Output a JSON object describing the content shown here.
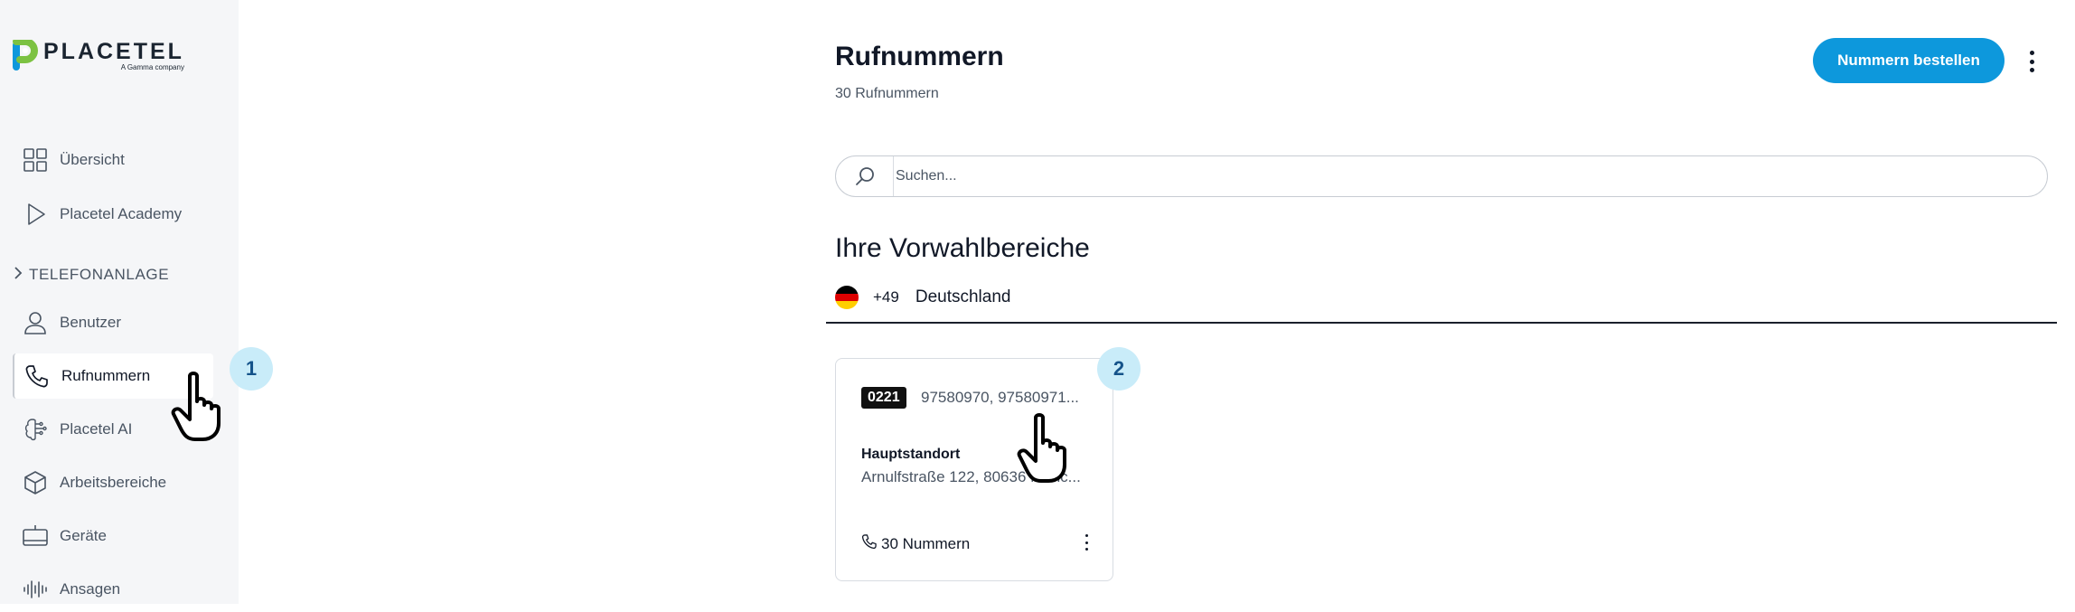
{
  "sidebar": {
    "logo": {
      "word": "PLACETEL",
      "tagline": "A Gamma company"
    },
    "items": [
      {
        "label": "Übersicht",
        "icon": "grid-icon"
      },
      {
        "label": "Placetel Academy",
        "icon": "play-icon"
      },
      {
        "label": "Benutzer",
        "icon": "user-icon"
      },
      {
        "label": "Rufnummern",
        "icon": "phone-icon"
      },
      {
        "label": "Placetel AI",
        "icon": "ai-brain-icon"
      },
      {
        "label": "Arbeitsbereiche",
        "icon": "cube-icon"
      },
      {
        "label": "Geräte",
        "icon": "device-icon"
      },
      {
        "label": "Ansagen",
        "icon": "audio-wave-icon"
      }
    ],
    "section": "TELEFONANLAGE"
  },
  "steps": {
    "one": "1",
    "two": "2"
  },
  "header": {
    "title": "Rufnummern",
    "subtitle": "30 Rufnummern",
    "order_button": "Nummern bestellen"
  },
  "search": {
    "placeholder": "Suchen..."
  },
  "areas": {
    "title": "Ihre Vorwahlbereiche",
    "country": {
      "code": "+49",
      "name": "Deutschland",
      "flag_colors": [
        "#000000",
        "#dd0000",
        "#ffce00"
      ]
    }
  },
  "card": {
    "prefix": "0221",
    "numbers": "97580970, 97580971...",
    "location_name": "Hauptstandort",
    "address": "Arnulfstraße 122, 80636 Münc...",
    "count": "30 Nummern"
  },
  "colors": {
    "accent": "#0d98dc",
    "badge_bg": "#c9ecf9",
    "badge_text": "#15538a"
  }
}
